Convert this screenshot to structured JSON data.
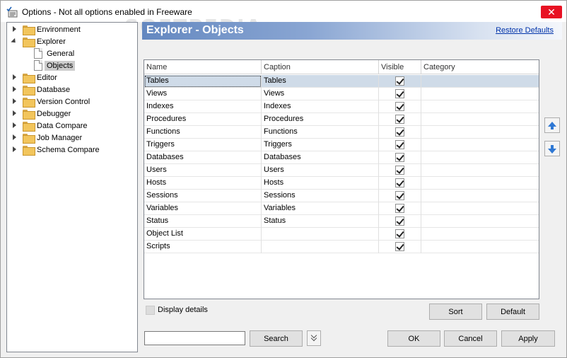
{
  "window": {
    "title": "Options - Not all options enabled in Freeware",
    "close_glyph": "✕",
    "watermark": "SOFTPEDIA"
  },
  "tree": {
    "items": [
      {
        "label": "Environment",
        "level": 0,
        "icon": "folder",
        "expander": "collapsed"
      },
      {
        "label": "Explorer",
        "level": 0,
        "icon": "folder-open",
        "expander": "expanded"
      },
      {
        "label": "General",
        "level": 1,
        "icon": "page",
        "expander": "none"
      },
      {
        "label": "Objects",
        "level": 1,
        "icon": "page",
        "expander": "none",
        "selected": true
      },
      {
        "label": "Editor",
        "level": 0,
        "icon": "folder",
        "expander": "collapsed"
      },
      {
        "label": "Database",
        "level": 0,
        "icon": "folder",
        "expander": "collapsed"
      },
      {
        "label": "Version Control",
        "level": 0,
        "icon": "folder",
        "expander": "collapsed"
      },
      {
        "label": "Debugger",
        "level": 0,
        "icon": "folder",
        "expander": "collapsed"
      },
      {
        "label": "Data Compare",
        "level": 0,
        "icon": "folder",
        "expander": "collapsed"
      },
      {
        "label": "Job Manager",
        "level": 0,
        "icon": "folder",
        "expander": "collapsed"
      },
      {
        "label": "Schema Compare",
        "level": 0,
        "icon": "folder",
        "expander": "collapsed"
      }
    ]
  },
  "header": {
    "title": "Explorer - Objects",
    "restore_link": "Restore Defaults"
  },
  "grid": {
    "columns": [
      "Name",
      "Caption",
      "Visible",
      "Category"
    ],
    "rows": [
      {
        "name": "Tables",
        "caption": "Tables",
        "visible": true,
        "category": "",
        "selected": true
      },
      {
        "name": "Views",
        "caption": "Views",
        "visible": true,
        "category": ""
      },
      {
        "name": "Indexes",
        "caption": "Indexes",
        "visible": true,
        "category": ""
      },
      {
        "name": "Procedures",
        "caption": "Procedures",
        "visible": true,
        "category": ""
      },
      {
        "name": "Functions",
        "caption": "Functions",
        "visible": true,
        "category": ""
      },
      {
        "name": "Triggers",
        "caption": "Triggers",
        "visible": true,
        "category": ""
      },
      {
        "name": "Databases",
        "caption": "Databases",
        "visible": true,
        "category": ""
      },
      {
        "name": "Users",
        "caption": "Users",
        "visible": true,
        "category": ""
      },
      {
        "name": "Hosts",
        "caption": "Hosts",
        "visible": true,
        "category": ""
      },
      {
        "name": "Sessions",
        "caption": "Sessions",
        "visible": true,
        "category": ""
      },
      {
        "name": "Variables",
        "caption": "Variables",
        "visible": true,
        "category": ""
      },
      {
        "name": "Status",
        "caption": "Status",
        "visible": true,
        "category": ""
      },
      {
        "name": "Object List",
        "caption": "",
        "visible": true,
        "category": ""
      },
      {
        "name": "Scripts",
        "caption": "",
        "visible": true,
        "category": ""
      }
    ]
  },
  "side_buttons": {
    "up_icon": "arrow-up-icon",
    "down_icon": "arrow-down-icon"
  },
  "bottom": {
    "display_details_label": "Display details",
    "display_details_checked": false,
    "sort_label": "Sort",
    "default_label": "Default",
    "search_value": "",
    "search_button_label": "Search",
    "ok_label": "OK",
    "cancel_label": "Cancel",
    "apply_label": "Apply"
  },
  "colors": {
    "banner_start": "#6488c0",
    "selected_row": "#cfdbe8",
    "close_button": "#e81123",
    "link": "#0033aa"
  }
}
